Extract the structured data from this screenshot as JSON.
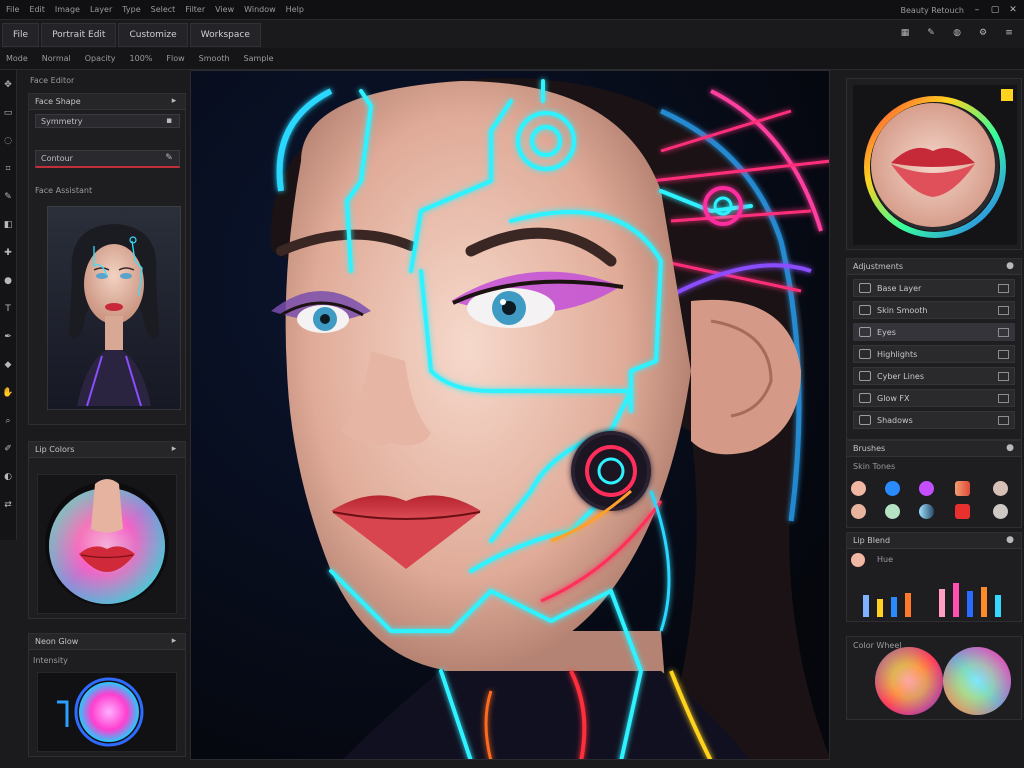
{
  "app": {
    "title_items": [
      "File",
      "Edit",
      "Image",
      "Layer",
      "Type",
      "Select",
      "Filter",
      "View",
      "Window",
      "Help"
    ],
    "top_right_label": "Beauty Retouch",
    "top_right_icons": [
      "minimize-icon",
      "maximize-icon",
      "close-icon"
    ]
  },
  "menubar": {
    "items": [
      "File",
      "Portrait Edit",
      "Customize",
      "Workspace"
    ],
    "right_icons": [
      "grid-icon",
      "brush-icon",
      "globe-icon",
      "gear-icon",
      "menu-icon"
    ]
  },
  "options": {
    "items": [
      "Mode",
      "Normal",
      "Opacity",
      "100%",
      "Flow",
      "Smooth",
      "Sample"
    ]
  },
  "left": {
    "section_title": "Face Editor",
    "face_panel": {
      "title": "Face Shape",
      "field1": "Symmetry",
      "field2": "Contour",
      "field3_label": "Face Assistant"
    },
    "lips_panel": {
      "title": "Lip Colors"
    },
    "glow_panel": {
      "title": "Neon Glow",
      "sub": "Intensity"
    }
  },
  "right": {
    "layers_panel": {
      "title": "Adjustments",
      "rows": [
        "Base Layer",
        "Skin Smooth",
        "Eyes",
        "Highlights",
        "Cyber Lines",
        "Glow FX",
        "Shadows"
      ]
    },
    "swatch_panel": {
      "title": "Brushes",
      "sub": "Skin Tones"
    },
    "color_panel": {
      "title": "Lip Blend",
      "sub": "Hue"
    },
    "wheel_panel": {
      "title": "Color Wheel"
    }
  },
  "colors": {
    "accent": "#00e5ff",
    "neon_pink": "#ff2fa0",
    "lip": "#d8323e",
    "panel": "#1e1e21"
  }
}
